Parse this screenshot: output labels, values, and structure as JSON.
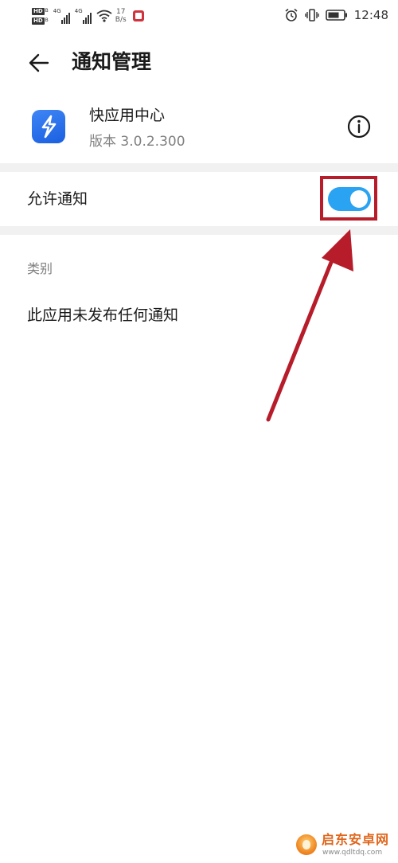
{
  "status_bar": {
    "hd_label": "HD",
    "hd_sub": "B",
    "network_label": "4G",
    "speed_value": "17",
    "speed_unit": "B/s",
    "time": "12:48",
    "icons": [
      "signal-icon",
      "wifi-icon",
      "app-notification-icon",
      "alarm-icon",
      "vibrate-icon",
      "battery-icon"
    ]
  },
  "header": {
    "title": "通知管理",
    "back_icon": "back-arrow-icon"
  },
  "app": {
    "name": "快应用中心",
    "version": "版本 3.0.2.300",
    "icon": "quick-app-center-icon",
    "info_icon": "info-icon",
    "icon_color": "#2f74ef"
  },
  "settings": {
    "allow_label": "允许通知",
    "allow_enabled": true,
    "toggle_color": "#2aa3f2"
  },
  "category": {
    "label": "类别",
    "empty_message": "此应用未发布任何通知"
  },
  "annotation": {
    "color": "#b71c2a",
    "type": "arrow-to-toggle"
  },
  "watermark": {
    "title": "启东安卓网",
    "url": "www.qdltdq.com"
  }
}
